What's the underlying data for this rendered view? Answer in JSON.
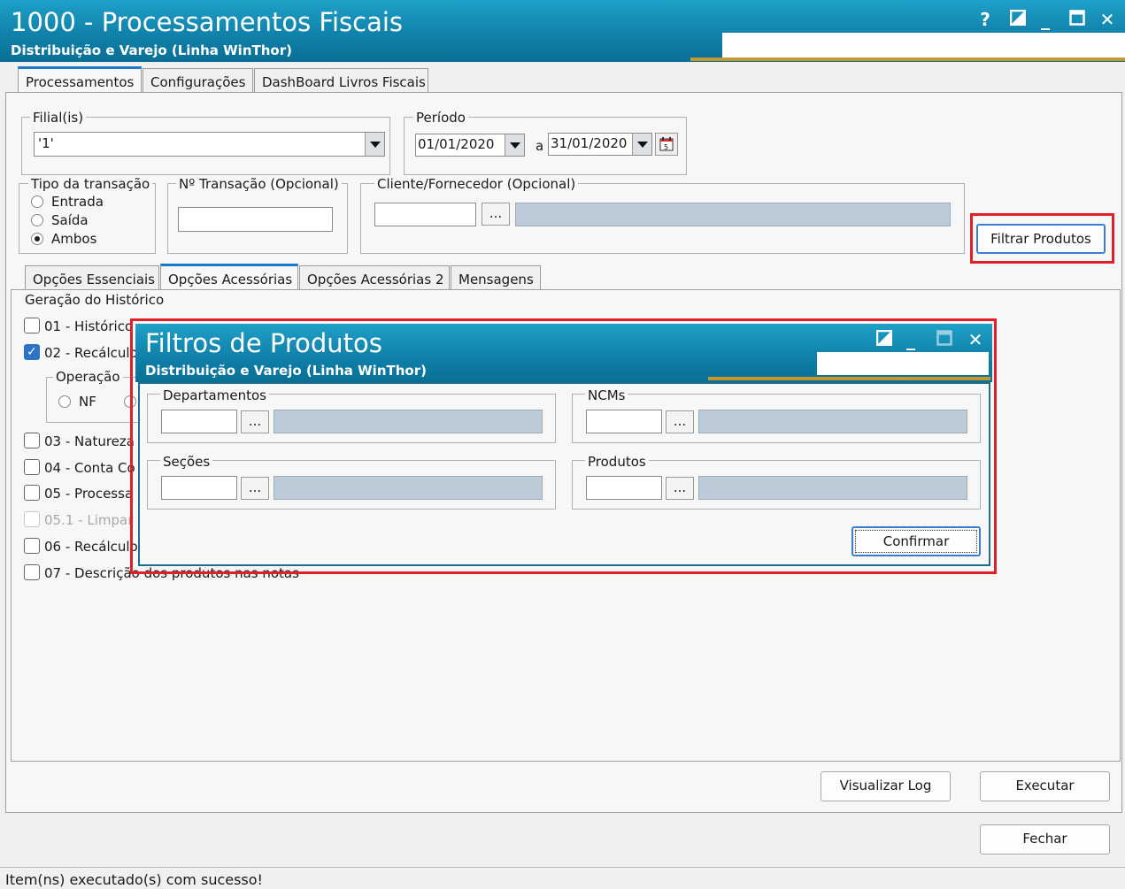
{
  "window": {
    "title": "1000 - Processamentos Fiscais",
    "subtitle": "Distribuição e Varejo (Linha WinThor)",
    "buttons": {
      "help": "?",
      "minimize": "_",
      "close": "✕"
    }
  },
  "tabs": [
    "Processamentos",
    "Configurações",
    "DashBoard Livros Fiscais"
  ],
  "filial": {
    "label": "Filial(is)",
    "value": "'1'"
  },
  "periodo": {
    "label": "Período",
    "start": "01/01/2020",
    "separator": "a",
    "end": "31/01/2020"
  },
  "tipo_transacao": {
    "label": "Tipo da transação",
    "options": [
      "Entrada",
      "Saída",
      "Ambos"
    ],
    "selected": "Ambos"
  },
  "num_transacao": {
    "label": "Nº Transação (Opcional)",
    "value": ""
  },
  "cliente_fornecedor": {
    "label": "Cliente/Fornecedor (Opcional)",
    "value": "",
    "lookup": "..."
  },
  "filtrar_produtos_label": "Filtrar Produtos",
  "sub_tabs": [
    "Opções Essenciais",
    "Opções Acessórias",
    "Opções Acessórias 2",
    "Mensagens"
  ],
  "geracao": {
    "label": "Geração do Histórico",
    "items": [
      {
        "label": "01 - Histórico",
        "checked": false,
        "disabled": false
      },
      {
        "label": "02 - Recálculo",
        "checked": true,
        "disabled": false
      },
      {
        "label": "03 - Natureza",
        "checked": false,
        "disabled": false
      },
      {
        "label": "04 - Conta Co",
        "checked": false,
        "disabled": false
      },
      {
        "label": "05 - Processa",
        "checked": false,
        "disabled": false
      },
      {
        "label": "05.1 - Limpar",
        "checked": false,
        "disabled": true
      },
      {
        "label": "06 - Recálculo",
        "checked": false,
        "disabled": false
      },
      {
        "label": "07 - Descrição dos produtos nas notas",
        "checked": false,
        "disabled": false
      }
    ],
    "operacao": {
      "label": "Operação",
      "option_nf": "NF"
    }
  },
  "buttons": {
    "visualizar_log": "Visualizar Log",
    "executar": "Executar",
    "fechar": "Fechar"
  },
  "status": "Item(ns) executado(s) com sucesso!",
  "dialog": {
    "title": "Filtros de Produtos",
    "subtitle": "Distribuição e Varejo (Linha WinThor)",
    "close": "✕",
    "groups": {
      "departamentos": "Departamentos",
      "ncms": "NCMs",
      "secoes": "Seções",
      "produtos": "Produtos"
    },
    "lookup": "...",
    "confirm_label": "Confirmar"
  },
  "colors": {
    "title_bar": "#0f7fa8",
    "highlight": "#e01f26",
    "tab_accent": "#1a79c8"
  }
}
